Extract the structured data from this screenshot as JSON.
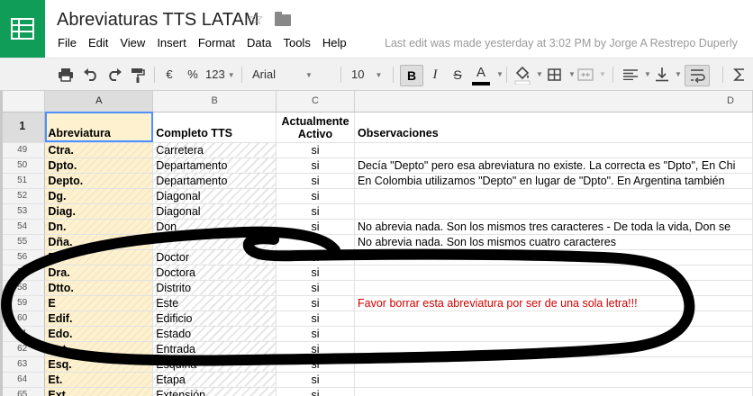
{
  "doc": {
    "title": "Abreviaturas TTS LATAM",
    "last_edit": "Last edit was made yesterday at 3:02 PM by Jorge A Restrepo Duperly"
  },
  "menu": [
    "File",
    "Edit",
    "View",
    "Insert",
    "Format",
    "Data",
    "Tools",
    "Help"
  ],
  "toolbar": {
    "currency": "€",
    "percent": "%",
    "number_format": "123",
    "font": "Arial",
    "font_size": "10",
    "bold": "B",
    "italic": "I",
    "strike": "S",
    "text_color": "A"
  },
  "columns": [
    "A",
    "B",
    "C",
    "D"
  ],
  "header_row": {
    "num": "1",
    "a": "Abreviatura",
    "b": "Completo TTS",
    "c1": "Actualmente",
    "c2": "Activo",
    "d": "Observaciones"
  },
  "rows": [
    {
      "num": "49",
      "a": "Ctra.",
      "b": "Carretera",
      "c": "si",
      "d": ""
    },
    {
      "num": "50",
      "a": "Dpto.",
      "b": "Departamento",
      "c": "si",
      "d": "Decía \"Depto\" pero esa abreviatura no existe. La correcta es \"Dpto\", En Chi"
    },
    {
      "num": "51",
      "a": "Depto.",
      "b": "Departamento",
      "c": "si",
      "d": "En Colombia utilizamos \"Depto\" en lugar de \"Dpto\". En Argentina también"
    },
    {
      "num": "52",
      "a": "Dg.",
      "b": "Diagonal",
      "c": "si",
      "d": ""
    },
    {
      "num": "53",
      "a": "Diag.",
      "b": "Diagonal",
      "c": "si",
      "d": ""
    },
    {
      "num": "54",
      "a": "Dn.",
      "b": "Don",
      "c": "si",
      "d": "No abrevia nada. Son los mismos tres caracteres - De toda la vida, Don se"
    },
    {
      "num": "55",
      "a": "Dña.",
      "b": "",
      "c": "",
      "d": "No abrevia nada. Son los mismos cuatro caracteres"
    },
    {
      "num": "56",
      "a": "Dr.",
      "b": "Doctor",
      "c": "si",
      "d": ""
    },
    {
      "num": "57",
      "a": "Dra.",
      "b": "Doctora",
      "c": "si",
      "d": ""
    },
    {
      "num": "58",
      "a": "Dtto.",
      "b": "Distrito",
      "c": "si",
      "d": ""
    },
    {
      "num": "59",
      "a": "E",
      "b": "Este",
      "c": "si",
      "d": "Favor borrar esta abreviatura por ser de una sola letra!!!"
    },
    {
      "num": "60",
      "a": "Edif.",
      "b": "Edificio",
      "c": "si",
      "d": ""
    },
    {
      "num": "61",
      "a": "Edo.",
      "b": "Estado",
      "c": "si",
      "d": ""
    },
    {
      "num": "62",
      "a": "Ent.",
      "b": "Entrada",
      "c": "si",
      "d": ""
    },
    {
      "num": "63",
      "a": "Esq.",
      "b": "Esquina",
      "c": "si",
      "d": ""
    },
    {
      "num": "64",
      "a": "Et.",
      "b": "Etapa",
      "c": "si",
      "d": ""
    },
    {
      "num": "65",
      "a": "Ext.",
      "b": "Extensión",
      "c": "si",
      "d": ""
    }
  ],
  "colors": {
    "brand": "#0f9d58",
    "warning_text": "#d00000",
    "highlight": "#fdf1cf",
    "selection": "#4d90fe"
  }
}
